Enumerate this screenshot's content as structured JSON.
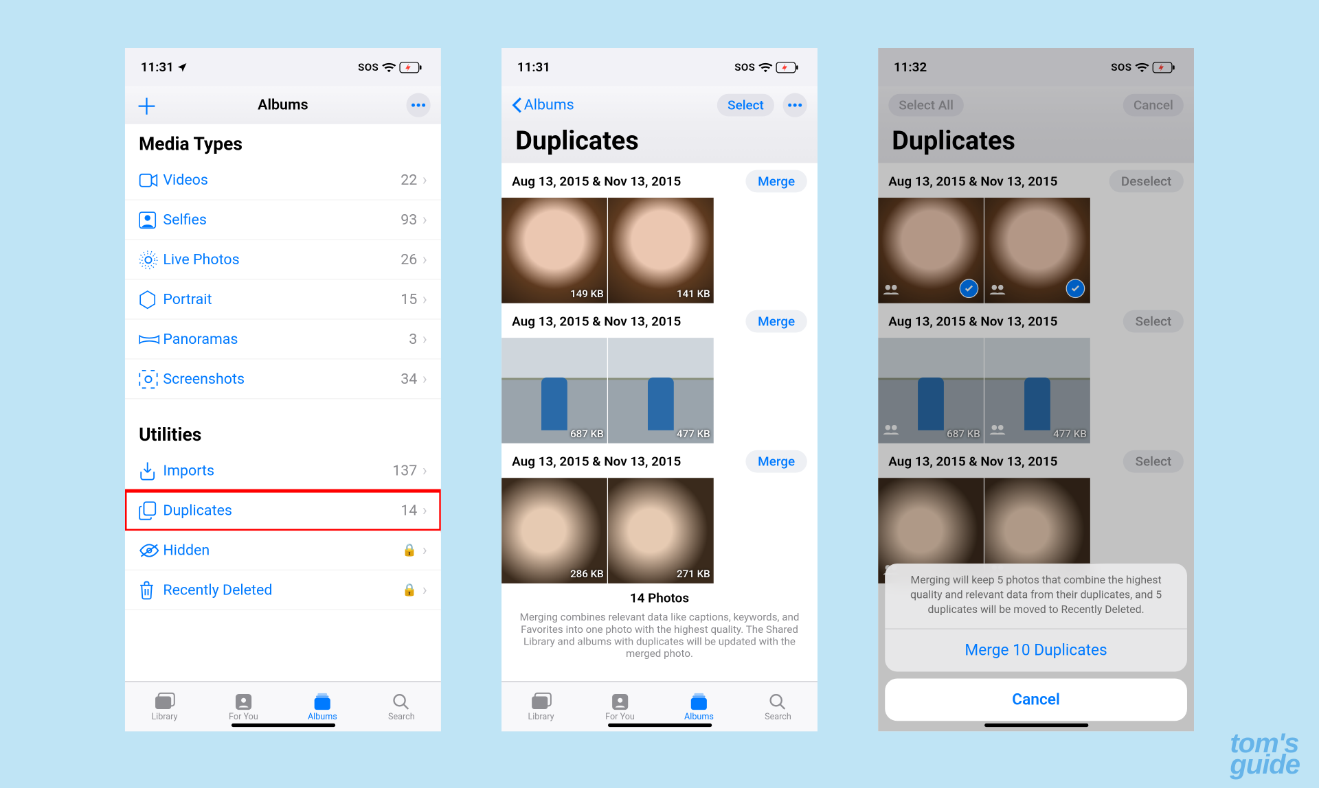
{
  "status": {
    "time1": "11:31",
    "time2": "11:31",
    "time3": "11:32",
    "sos": "SOS"
  },
  "screen1": {
    "title": "Albums",
    "mediaTypes": {
      "header": "Media Types",
      "items": [
        {
          "label": "Videos",
          "count": "22"
        },
        {
          "label": "Selfies",
          "count": "93"
        },
        {
          "label": "Live Photos",
          "count": "26"
        },
        {
          "label": "Portrait",
          "count": "15"
        },
        {
          "label": "Panoramas",
          "count": "3"
        },
        {
          "label": "Screenshots",
          "count": "34"
        }
      ]
    },
    "utilities": {
      "header": "Utilities",
      "items": [
        {
          "label": "Imports",
          "count": "137",
          "lock": false
        },
        {
          "label": "Duplicates",
          "count": "14",
          "lock": false,
          "highlight": true
        },
        {
          "label": "Hidden",
          "count": "",
          "lock": true
        },
        {
          "label": "Recently Deleted",
          "count": "",
          "lock": true
        }
      ]
    }
  },
  "screen2": {
    "back": "Albums",
    "title": "Duplicates",
    "select": "Select",
    "groups": [
      {
        "date": "Aug 13, 2015 & Nov 13, 2015",
        "action": "Merge",
        "sizes": [
          "149 KB",
          "141 KB"
        ]
      },
      {
        "date": "Aug 13, 2015 & Nov 13, 2015",
        "action": "Merge",
        "sizes": [
          "687 KB",
          "477 KB"
        ]
      },
      {
        "date": "Aug 13, 2015 & Nov 13, 2015",
        "action": "Merge",
        "sizes": [
          "286 KB",
          "271 KB"
        ]
      }
    ],
    "footerTitle": "14 Photos",
    "footerNote": "Merging combines relevant data like captions, keywords, and Favorites into one photo with the highest quality. The Shared Library and albums with duplicates will be updated with the merged photo."
  },
  "screen3": {
    "selectAll": "Select All",
    "cancel": "Cancel",
    "title": "Duplicates",
    "groups": [
      {
        "date": "Aug 13, 2015 & Nov 13, 2015",
        "action": "Deselect",
        "checked": true
      },
      {
        "date": "Aug 13, 2015 & Nov 13, 2015",
        "action": "Select",
        "sizes": [
          "687 KB",
          "477 KB"
        ]
      },
      {
        "date": "Aug 13, 2015 & Nov 13, 2015",
        "action": "Select"
      }
    ],
    "sheet": {
      "msg": "Merging will keep 5 photos that combine the highest quality and relevant data from their duplicates, and 5 duplicates will be moved to Recently Deleted.",
      "merge": "Merge 10 Duplicates",
      "cancel": "Cancel"
    }
  },
  "tabs": [
    "Library",
    "For You",
    "Albums",
    "Search"
  ],
  "watermark": {
    "l1": "tom's",
    "l2": "guide"
  }
}
